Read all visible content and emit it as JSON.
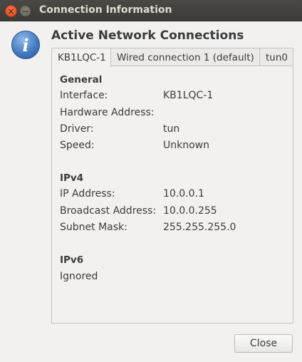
{
  "window": {
    "title": "Connection Information",
    "close_glyph": "×",
    "minimize_glyph": "−"
  },
  "dialog": {
    "icon": "information-icon",
    "icon_glyph": "i",
    "heading": "Active Network Connections"
  },
  "tabs": [
    {
      "label": "KB1LQC-1",
      "active": true
    },
    {
      "label": "Wired connection 1 (default)",
      "active": false
    },
    {
      "label": "tun0",
      "active": false
    }
  ],
  "general": {
    "title": "General",
    "interface_label": "Interface:",
    "interface_value": "KB1LQC-1",
    "hardware_label": "Hardware Address:",
    "hardware_value": "",
    "driver_label": "Driver:",
    "driver_value": "tun",
    "speed_label": "Speed:",
    "speed_value": "Unknown"
  },
  "ipv4": {
    "title": "IPv4",
    "ip_label": "IP Address:",
    "ip_value": "10.0.0.1",
    "broadcast_label": "Broadcast Address:",
    "broadcast_value": "10.0.0.255",
    "subnet_label": "Subnet Mask:",
    "subnet_value": "255.255.255.0"
  },
  "ipv6": {
    "title": "IPv6",
    "status": "Ignored"
  },
  "buttons": {
    "close_label": "Close"
  }
}
